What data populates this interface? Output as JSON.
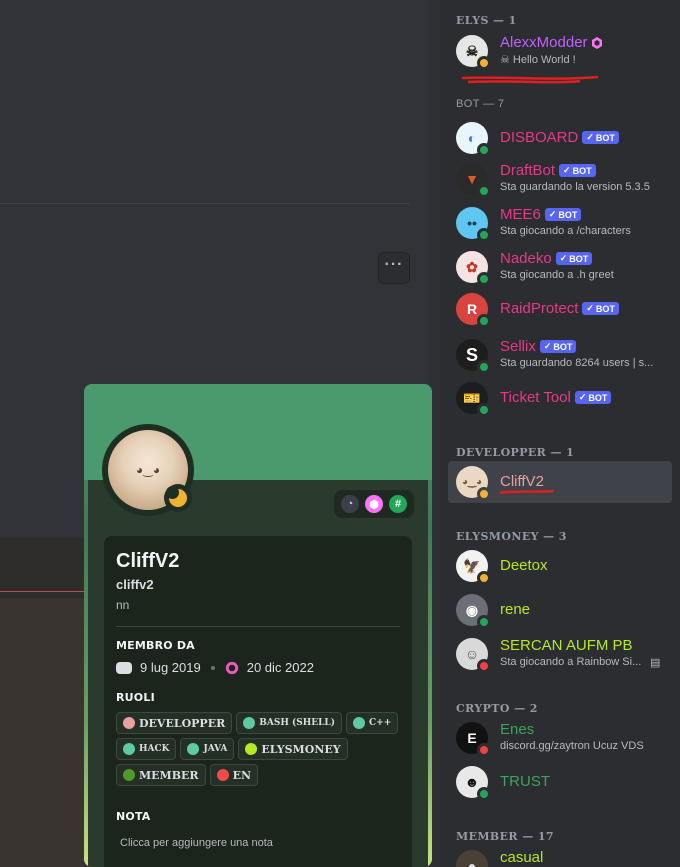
{
  "chat": {
    "more_label": "···"
  },
  "sidebar": {
    "groups": [
      {
        "header": "ELYS — 1"
      },
      {
        "header": "BOT — 7"
      },
      {
        "header": "DEVELOPPER — 1"
      },
      {
        "header": "ELYSMONEY — 3"
      },
      {
        "header": "CRYPTO — 2"
      },
      {
        "header": "MEMBER — 17"
      }
    ],
    "members": {
      "alexx": {
        "name": "AlexxModder",
        "sub": "Hello World !",
        "color": "#c061ff"
      },
      "disboard": {
        "name": "DISBOARD",
        "tag": "BOT",
        "color": "#e8388a"
      },
      "draftbot": {
        "name": "DraftBot",
        "tag": "BOT",
        "sub": "Sta guardando la version 5.3.5",
        "color": "#e8388a"
      },
      "mee6": {
        "name": "MEE6",
        "tag": "BOT",
        "sub": "Sta giocando a /characters",
        "color": "#e8388a"
      },
      "nadeko": {
        "name": "Nadeko",
        "tag": "BOT",
        "sub": "Sta giocando a .h greet",
        "color": "#e8388a"
      },
      "raidprotect": {
        "name": "RaidProtect",
        "tag": "BOT",
        "color": "#e8388a"
      },
      "sellix": {
        "name": "Sellix",
        "tag": "BOT",
        "sub": "Sta guardando 8264 users | s...",
        "color": "#e8388a"
      },
      "tickettool": {
        "name": "Ticket Tool",
        "tag": "BOT",
        "color": "#e8388a"
      },
      "cliff": {
        "name": "CliffV2",
        "color": "#e8a0a0"
      },
      "deetox": {
        "name": "Deetox",
        "color": "#b5ea22"
      },
      "rene": {
        "name": "rene",
        "color": "#b5ea22"
      },
      "sercan": {
        "name": "SERCAN AUFM PB",
        "sub": "Sta giocando a Rainbow Si...",
        "color": "#b5ea22"
      },
      "enes": {
        "name": "Enes",
        "sub": "discord.gg/zaytron Ucuz VDS",
        "color": "#3ba55c"
      },
      "trust": {
        "name": "TRUST",
        "color": "#3ba55c"
      },
      "casual": {
        "name": "casual",
        "color": "#b5ea22"
      }
    }
  },
  "profile": {
    "display_name": "CliffV2",
    "username": "cliffv2",
    "pronouns": "nn",
    "member_since_label": "MEMBRO DA",
    "discord_date": "9 lug 2019",
    "server_date": "20 dic 2022",
    "roles_label": "RUOLI",
    "roles": [
      {
        "name": "DEVELOPPER",
        "color": "#e8a0a0"
      },
      {
        "name": "BASH (SHELL)",
        "color": "#5fc9a3"
      },
      {
        "name": "C++",
        "color": "#5fc9a3"
      },
      {
        "name": "HACK",
        "color": "#5fc9a3"
      },
      {
        "name": "JAVA",
        "color": "#5fc9a3"
      },
      {
        "name": "ELYSMONEY",
        "color": "#b5ea22"
      },
      {
        "name": "MEMBER",
        "color": "#4f9a2a"
      },
      {
        "name": "EN",
        "color": "#f04b4b"
      }
    ],
    "note_label": "NOTA",
    "note_placeholder": "Clicca per aggiungere una nota"
  }
}
